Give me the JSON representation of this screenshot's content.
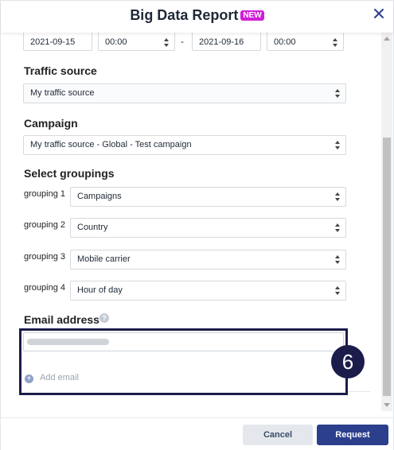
{
  "header": {
    "title": "Big Data Report",
    "badge": "NEW",
    "close_icon": "close-icon"
  },
  "date_range": {
    "start_date": "2021-09-15",
    "start_time": "00:00",
    "separator": "-",
    "end_date": "2021-09-16",
    "end_time": "00:00"
  },
  "traffic_source": {
    "label": "Traffic source",
    "value": "My traffic source"
  },
  "campaign": {
    "label": "Campaign",
    "value": "My traffic source - Global - Test campaign"
  },
  "groupings": {
    "label": "Select groupings",
    "items": [
      {
        "label": "grouping 1",
        "value": "Campaigns"
      },
      {
        "label": "grouping 2",
        "value": "Country"
      },
      {
        "label": "grouping 3",
        "value": "Mobile carrier"
      },
      {
        "label": "grouping 4",
        "value": "Hour of day"
      }
    ]
  },
  "email": {
    "label": "Email address",
    "help_icon": "?",
    "add_label": "Add email",
    "add_icon": "+"
  },
  "step": {
    "number": "6"
  },
  "footer": {
    "cancel_label": "Cancel",
    "request_label": "Request"
  },
  "colors": {
    "accent": "#2b3f8c",
    "highlight": "#1b1c4a",
    "badge": "#d11fd6"
  }
}
